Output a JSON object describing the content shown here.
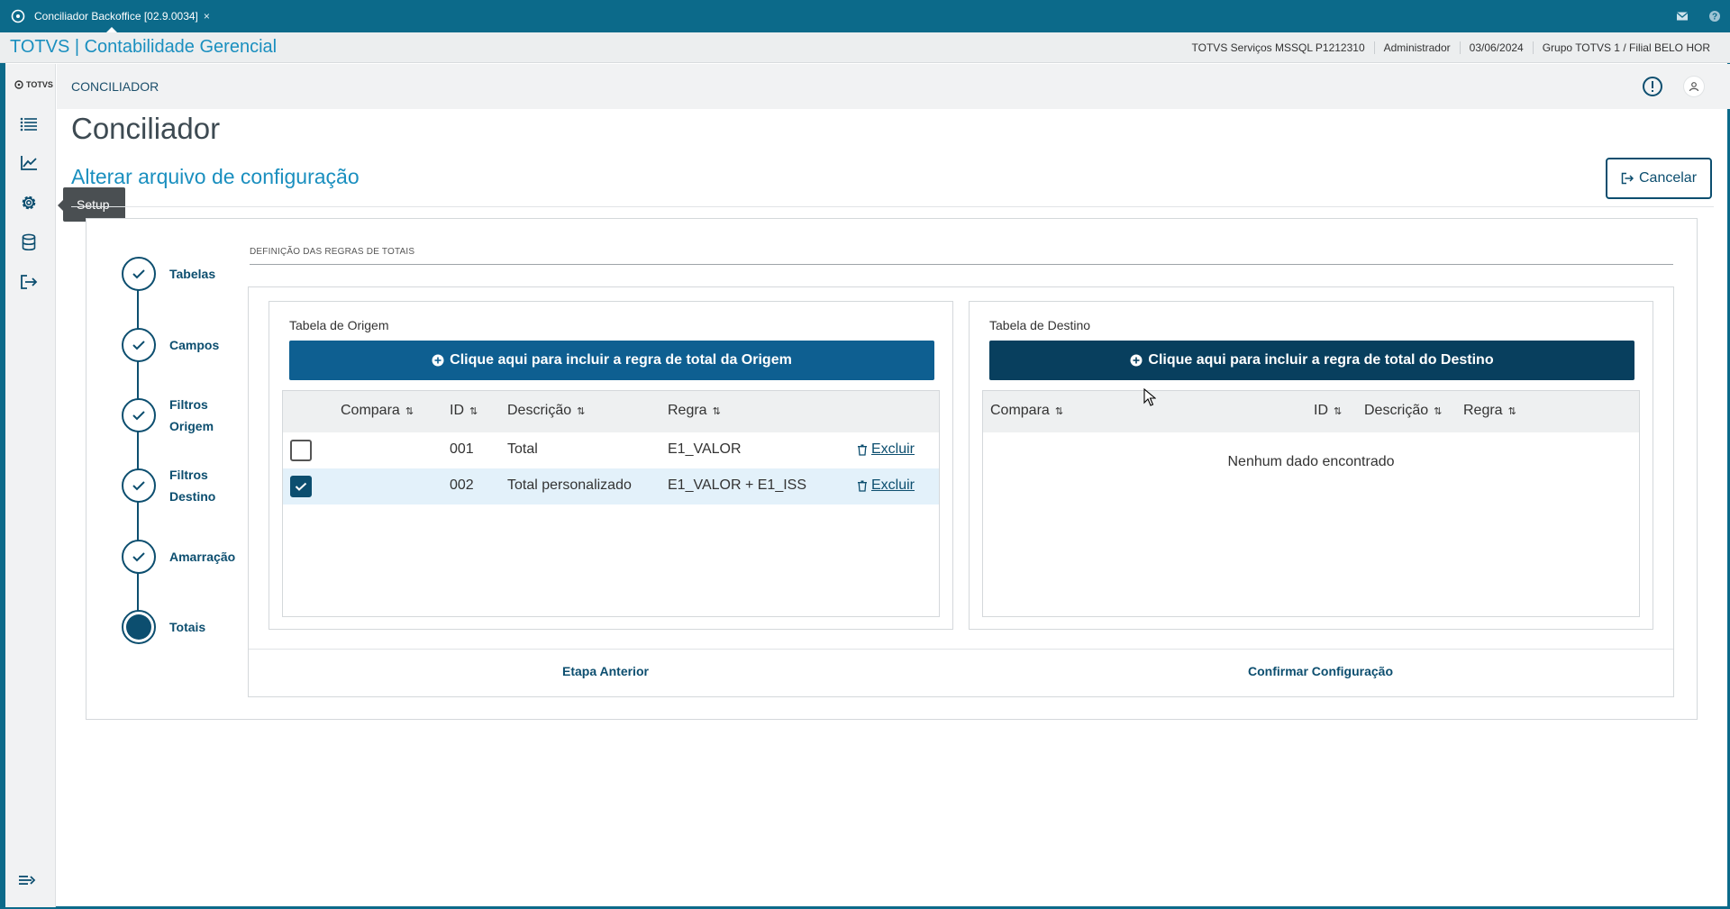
{
  "window": {
    "tab_title": "Conciliador Backoffice [02.9.0034]",
    "tab_close": "×"
  },
  "header": {
    "brand": "TOTVS | Contabilidade Gerencial",
    "environment": "TOTVS Serviços MSSQL P1212310",
    "user": "Administrador",
    "date": "03/06/2024",
    "branch": "Grupo TOTVS 1 / Filial BELO HOR"
  },
  "sidebar": {
    "logo_text": "TOTVS",
    "items": [
      {
        "icon": "list-icon"
      },
      {
        "icon": "chart-icon"
      },
      {
        "icon": "gear-icon",
        "tooltip": "Setup"
      },
      {
        "icon": "database-icon"
      },
      {
        "icon": "logout-icon"
      }
    ],
    "tooltip": "Setup"
  },
  "breadcrumb": "CONCILIADOR",
  "page": {
    "title": "Conciliador",
    "section_title": "Alterar arquivo de configuração",
    "cancel_label": "Cancelar"
  },
  "stepper": {
    "steps": [
      {
        "label": "Tabelas",
        "status": "done"
      },
      {
        "label": "Campos",
        "status": "done"
      },
      {
        "label": "Filtros Origem",
        "status": "done"
      },
      {
        "label": "Filtros Destino",
        "status": "done"
      },
      {
        "label": "Amarração",
        "status": "done"
      },
      {
        "label": "Totais",
        "status": "current"
      }
    ],
    "line1": [
      "Tabelas",
      "Campos",
      "Filtros",
      "Filtros",
      "Amarração",
      "Totais"
    ],
    "line2": [
      "",
      "",
      "Origem",
      "Destino",
      "",
      ""
    ]
  },
  "section_heading": "DEFINIÇÃO DAS REGRAS DE TOTAIS",
  "origem": {
    "title": "Tabela de Origem",
    "add_button": "Clique aqui para incluir a regra de total da Origem",
    "columns": [
      "Compara",
      "ID",
      "Descrição",
      "Regra"
    ],
    "rows": [
      {
        "selected": false,
        "id": "001",
        "descricao": "Total",
        "regra": "E1_VALOR",
        "action": "Excluir"
      },
      {
        "selected": true,
        "id": "002",
        "descricao": "Total personalizado",
        "regra": "E1_VALOR + E1_ISS",
        "action": "Excluir"
      }
    ]
  },
  "destino": {
    "title": "Tabela de Destino",
    "add_button": "Clique aqui para incluir a regra de total do Destino",
    "columns": [
      "Compara",
      "ID",
      "Descrição",
      "Regra"
    ],
    "empty_message": "Nenhum dado encontrado"
  },
  "footer": {
    "previous": "Etapa Anterior",
    "confirm": "Confirmar Configuração"
  },
  "colors": {
    "topbar": "#0c6a8a",
    "primary": "#0c4e6f",
    "origem_button": "#0e5f91",
    "destino_button": "#083f5e",
    "brand_text": "#1a8fbf"
  }
}
